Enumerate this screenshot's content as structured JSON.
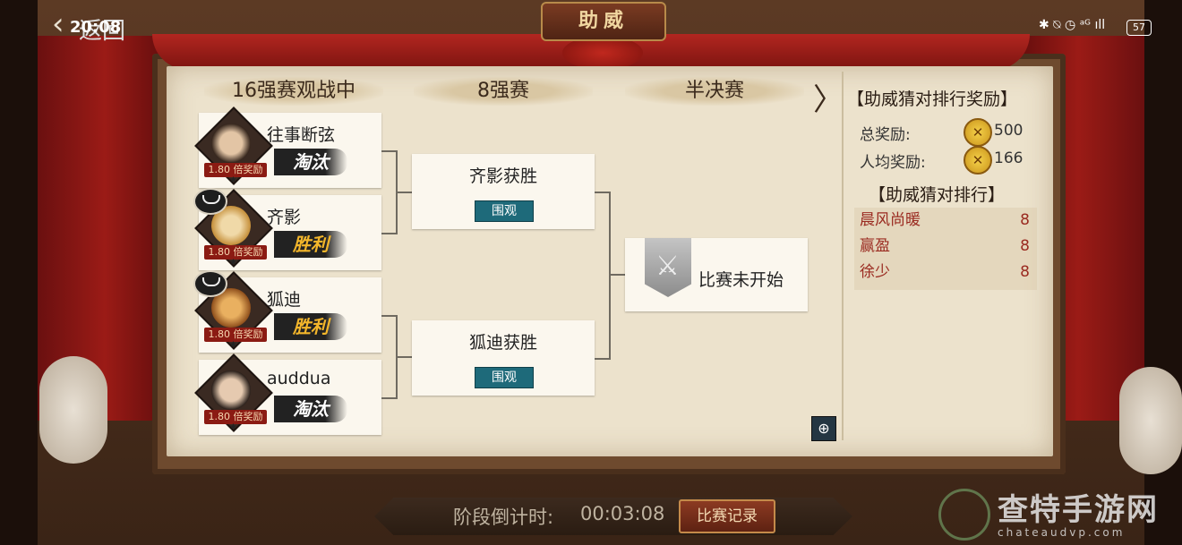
{
  "status_bar": {
    "time": "20:08",
    "battery": "57",
    "icons": "✱ ⍉ ◷ ᵃᴳ ıll"
  },
  "nav": {
    "back_label": "返回",
    "back_glyph": "‹"
  },
  "title": "助威",
  "rounds": {
    "r16": "16强赛观战中",
    "qf": "8强赛",
    "sf": "半决赛",
    "next_glyph": "〉"
  },
  "players": [
    {
      "name": "往事断弦",
      "multiplier": "1.80 倍奖励",
      "result": "淘汰"
    },
    {
      "name": "齐影",
      "multiplier": "1.80 倍奖励",
      "result": "胜利"
    },
    {
      "name": "狐迪",
      "multiplier": "1.80 倍奖励",
      "result": "胜利"
    },
    {
      "name": "auddua",
      "multiplier": "1.80 倍奖励",
      "result": "淘汰"
    }
  ],
  "matches": [
    {
      "title": "齐影获胜",
      "button": "围观"
    },
    {
      "title": "狐迪获胜",
      "button": "围观"
    }
  ],
  "semifinal": {
    "status": "比赛未开始"
  },
  "rewards": {
    "title": "【助威猜对排行奖励】",
    "total_label": "总奖励:",
    "total_value": "500",
    "per_person_label": "人均奖励:",
    "per_person_value": "166"
  },
  "ranking": {
    "title": "【助威猜对排行】",
    "rows": [
      {
        "name": "晨风尚暖",
        "score": "8"
      },
      {
        "name": "赢盈",
        "score": "8"
      },
      {
        "name": "徐少",
        "score": "8"
      }
    ]
  },
  "bottom": {
    "countdown_label": "阶段倒计时:",
    "countdown_value": "00:03:08",
    "record_button": "比赛记录"
  },
  "watermark": {
    "text": "查特手游网",
    "url": "chateaudvp.com"
  }
}
